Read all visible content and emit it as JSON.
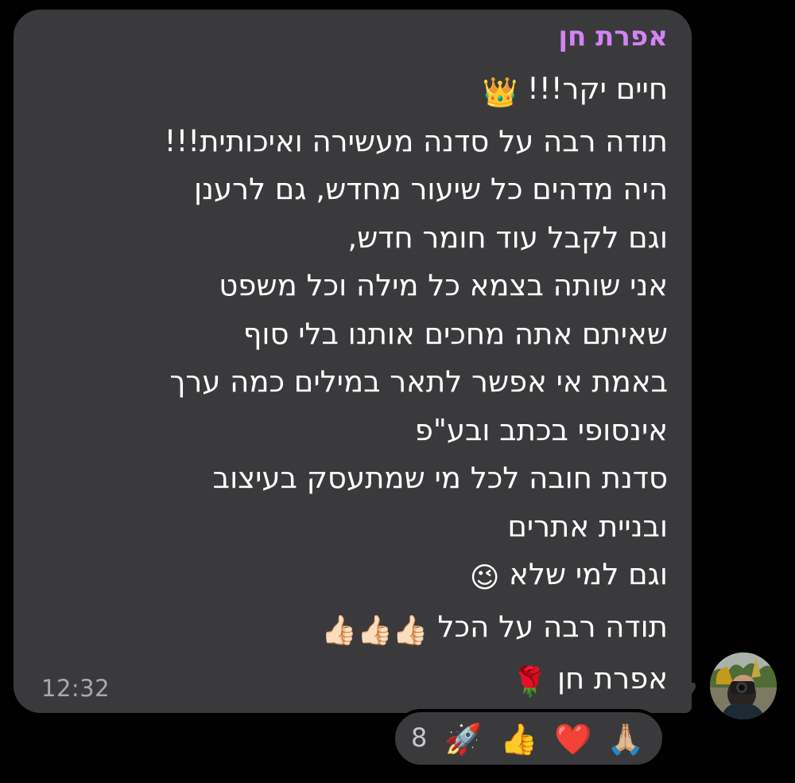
{
  "message": {
    "sender_name": "אפרת חן",
    "lines": [
      {
        "text": "חיים יקר!!!",
        "emoji": "👑"
      },
      {
        "text": "תודה רבה על סדנה מעשירה ואיכותית!!!",
        "emoji": ""
      },
      {
        "text": "היה מדהים כל שיעור מחדש, גם לרענן",
        "emoji": ""
      },
      {
        "text": "וגם לקבל עוד חומר חדש,",
        "emoji": ""
      },
      {
        "text": "אני שותה בצמא כל מילה וכל משפט",
        "emoji": ""
      },
      {
        "text": "שאיתם אתה מחכים אותנו בלי סוף",
        "emoji": ""
      },
      {
        "text": "באמת אי אפשר לתאר במילים כמה ערך",
        "emoji": ""
      },
      {
        "text": "אינסופי בכתב ובע\"פ",
        "emoji": ""
      },
      {
        "text": "סדנת חובה לכל מי שמתעסק בעיצוב",
        "emoji": ""
      },
      {
        "text": "ובניית אתרים",
        "emoji": ""
      },
      {
        "text": "וגם למי שלא",
        "emoji": "😉"
      },
      {
        "text": "תודה רבה על הכל",
        "emoji": "👍🏻👍🏻👍🏻"
      },
      {
        "text": "אפרת חן",
        "emoji": "🌹"
      }
    ],
    "timestamp": "12:32"
  },
  "reactions": {
    "count": "8",
    "items": [
      {
        "emoji": "🚀",
        "name": "rocket"
      },
      {
        "emoji": "👍",
        "name": "thumbs-up"
      },
      {
        "emoji": "❤️",
        "name": "red-heart"
      },
      {
        "emoji": "🙏🏼",
        "name": "folded-hands"
      }
    ]
  },
  "colors": {
    "background": "#000000",
    "bubble": "#3a3a3c",
    "sender_name": "#d283f4",
    "message_text": "#ffffff",
    "timestamp": "#a8a8ae"
  }
}
